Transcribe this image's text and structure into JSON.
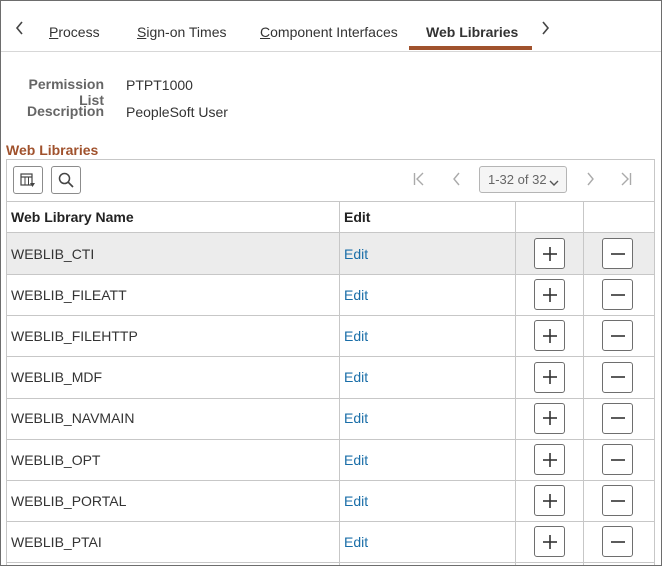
{
  "tabs": {
    "items": [
      {
        "label": "Process",
        "underline_char": "P",
        "rest": "rocess"
      },
      {
        "label": "Sign-on Times",
        "underline_char": "S",
        "rest": "ign-on Times"
      },
      {
        "label": "Component Interfaces",
        "underline_char": "C",
        "rest": "omponent Interfaces"
      },
      {
        "label": "Web Libraries",
        "active": true
      }
    ]
  },
  "header": {
    "permission_list_label": "Permission List",
    "permission_list_value": "PTPT1000",
    "description_label": "Description",
    "description_value": "PeopleSoft User"
  },
  "section": {
    "title": "Web Libraries"
  },
  "grid": {
    "pager_text": "1-32 of 32",
    "columns": [
      "Web Library Name",
      "Edit",
      "",
      ""
    ],
    "rows": [
      {
        "name": "WEBLIB_CTI",
        "edit": "Edit"
      },
      {
        "name": "WEBLIB_FILEATT",
        "edit": "Edit"
      },
      {
        "name": "WEBLIB_FILEHTTP",
        "edit": "Edit"
      },
      {
        "name": "WEBLIB_MDF",
        "edit": "Edit"
      },
      {
        "name": "WEBLIB_NAVMAIN",
        "edit": "Edit"
      },
      {
        "name": "WEBLIB_OPT",
        "edit": "Edit"
      },
      {
        "name": "WEBLIB_PORTAL",
        "edit": "Edit"
      },
      {
        "name": "WEBLIB_PTAI",
        "edit": "Edit"
      }
    ]
  },
  "colors": {
    "accent": "#a0522d",
    "link": "#1a6ea8",
    "row_highlight": "#ececec"
  }
}
